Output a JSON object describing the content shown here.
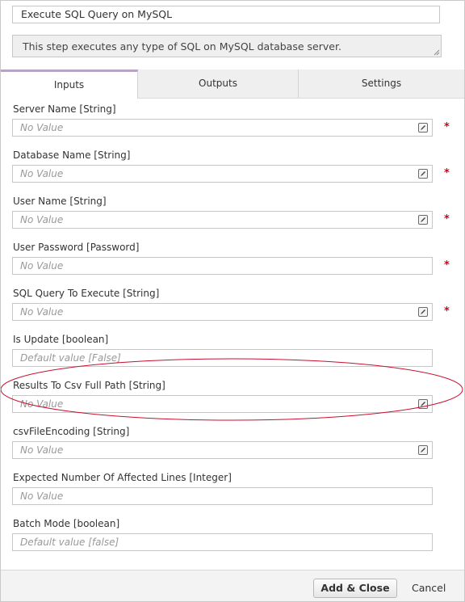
{
  "header": {
    "step_title": "Execute SQL Query on MySQL",
    "description": "This step executes any type of SQL on MySQL database server."
  },
  "tabs": [
    {
      "label": "Inputs",
      "active": true
    },
    {
      "label": "Outputs",
      "active": false
    },
    {
      "label": "Settings",
      "active": false
    }
  ],
  "fields": [
    {
      "label": "Server Name [String]",
      "placeholder": "No Value",
      "has_editor": true,
      "required": true
    },
    {
      "label": "Database Name [String]",
      "placeholder": "No Value",
      "has_editor": true,
      "required": true
    },
    {
      "label": "User Name [String]",
      "placeholder": "No Value",
      "has_editor": true,
      "required": true
    },
    {
      "label": "User Password [Password]",
      "placeholder": "No Value",
      "has_editor": false,
      "required": true
    },
    {
      "label": "SQL Query To Execute [String]",
      "placeholder": "No Value",
      "has_editor": true,
      "required": true
    },
    {
      "label": "Is Update [boolean]",
      "placeholder": "Default value [False]",
      "has_editor": false,
      "required": false
    },
    {
      "label": "Results To Csv Full Path [String]",
      "placeholder": "No Value",
      "has_editor": true,
      "required": false
    },
    {
      "label": "csvFileEncoding [String]",
      "placeholder": "No Value",
      "has_editor": true,
      "required": false
    },
    {
      "label": "Expected Number Of Affected Lines [Integer]",
      "placeholder": "No Value",
      "has_editor": false,
      "required": false
    },
    {
      "label": "Batch Mode [boolean]",
      "placeholder": "Default value [false]",
      "has_editor": false,
      "required": false
    }
  ],
  "required_marker": "*",
  "footer": {
    "add_close_label": "Add & Close",
    "cancel_label": "Cancel"
  },
  "colors": {
    "active_tab_accent": "#b9a3c4",
    "required": "#d4001a",
    "highlight_ellipse": "#c8102e"
  }
}
